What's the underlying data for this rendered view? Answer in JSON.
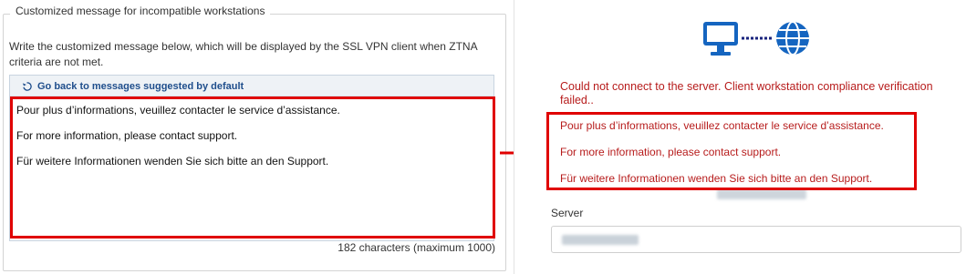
{
  "left": {
    "legend": "Customized message for incompatible workstations",
    "description": "Write the customized message below, which will be displayed by the SSL VPN client when ZTNA criteria are not met.",
    "reset_link": "Go back to messages suggested by default",
    "reset_icon": "undo-icon",
    "messages": [
      "Pour plus d’informations, veuillez contacter le service d’assistance.",
      "For more information, please contact support.",
      "Für weitere Informationen wenden Sie sich bitte an den Support."
    ],
    "counter": "182 characters (maximum 1000)"
  },
  "right": {
    "icons": [
      "monitor-icon",
      "globe-icon"
    ],
    "error_main": "Could not connect to the server. Client workstation compliance verification failed..",
    "messages": [
      "Pour plus d’informations, veuillez contacter le service d’assistance.",
      "For more information, please contact support.",
      "Für weitere Informationen wenden Sie sich bitte an den Support."
    ],
    "server_label": "Server",
    "server_value": ""
  },
  "colors": {
    "highlight": "#e00000",
    "error_text": "#b71c1c",
    "icon_blue": "#1565c0",
    "link": "#1f4e8c"
  }
}
